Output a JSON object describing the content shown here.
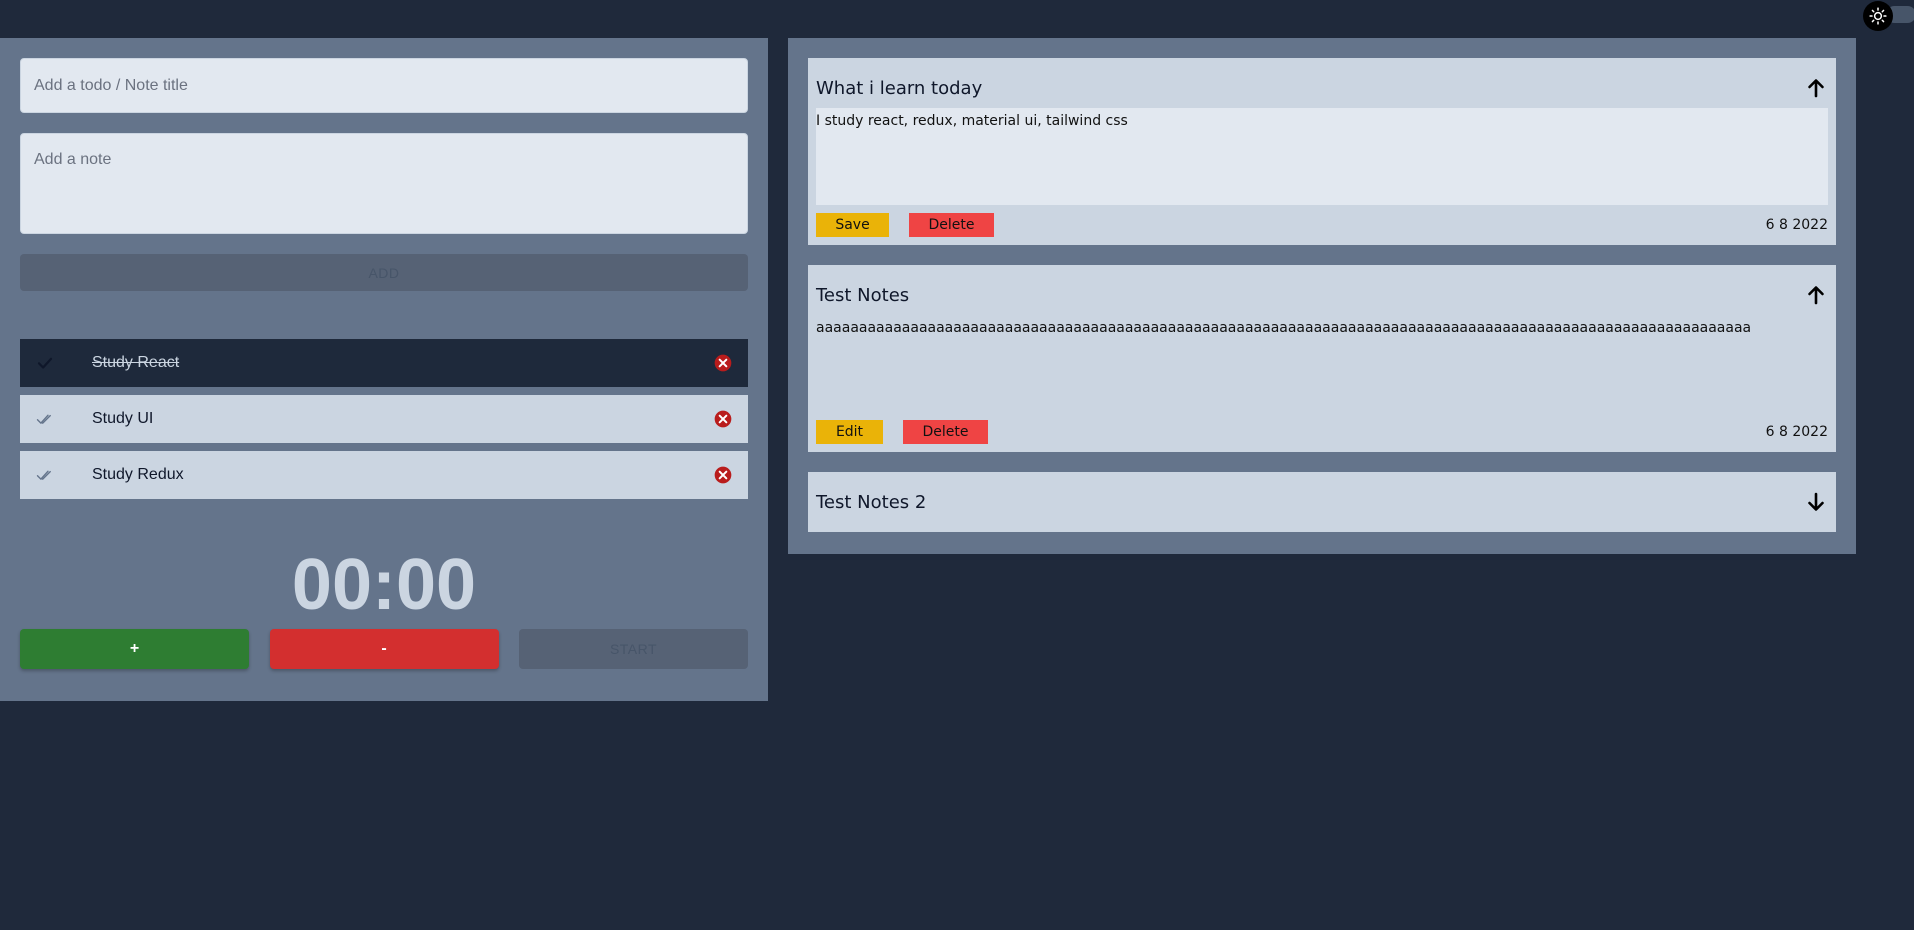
{
  "theme_toggle": {
    "icon": "sun-icon"
  },
  "form": {
    "title_placeholder": "Add a todo / Note title",
    "note_placeholder": "Add a note",
    "add_label": "ADD"
  },
  "todos": [
    {
      "text": "Study React",
      "done": true
    },
    {
      "text": "Study UI",
      "done": false
    },
    {
      "text": "Study Redux",
      "done": false
    }
  ],
  "timer": {
    "display": "00:00",
    "plus_label": "+",
    "minus_label": "-",
    "start_label": "START"
  },
  "notes": [
    {
      "title": "What i learn today",
      "body": "I study react, redux, material ui, tailwind css",
      "primary_label": "Save",
      "delete_label": "Delete",
      "date": "6 8 2022",
      "expanded": true,
      "arrow": "arrow-up-icon"
    },
    {
      "title": "Test Notes",
      "body": "aaaaaaaaaaaaaaaaaaaaaaaaaaaaaaaaaaaaaaaaaaaaaaaaaaaaaaaaaaaaaaaaaaaaaaaaaaaaaaaaaaaaaaaaaaaaaaaaaaaaaaaaaaaaa",
      "primary_label": "Edit",
      "delete_label": "Delete",
      "date": "6 8 2022",
      "expanded": true,
      "arrow": "arrow-up-icon"
    },
    {
      "title": "Test Notes 2",
      "expanded": false,
      "arrow": "arrow-down-icon"
    }
  ],
  "colors": {
    "background": "#1f293b",
    "panel": "#64748b",
    "card": "#cbd5e1",
    "done_item": "#1e293b",
    "yellow": "#eab308",
    "red": "#ef4444",
    "green_button": "#2e7d32",
    "red_button": "#d32f2f"
  }
}
